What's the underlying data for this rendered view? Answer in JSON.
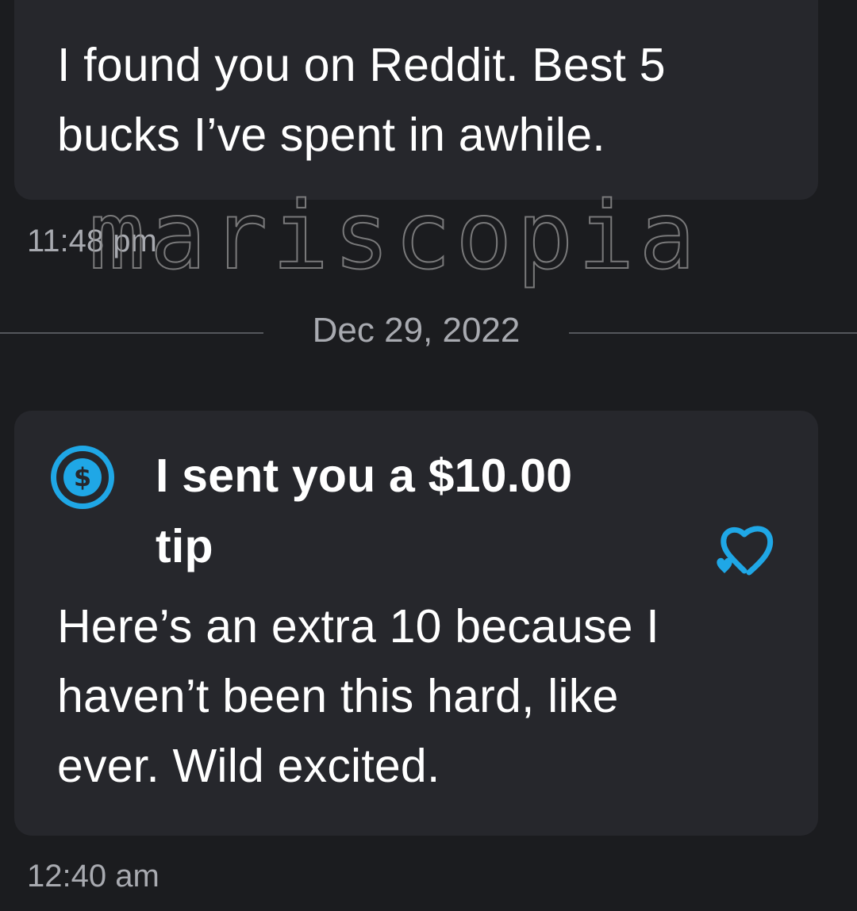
{
  "messages": [
    {
      "text": "I found you on Reddit. Best 5\nbucks I’ve spent in awhile.",
      "time": "11:48 pm"
    },
    {
      "tip": {
        "icon": "dollar-circle-icon",
        "label": "I sent you a $10.00\ntip",
        "reaction_icon": "heart-outline-icon"
      },
      "text": "Here’s an extra 10 because I\nhaven’t been this hard, like\never. Wild excited.",
      "time": "12:40 am"
    }
  ],
  "date_divider": "Dec 29, 2022",
  "watermark": "mariscopia",
  "colors": {
    "background": "#1b1c1f",
    "bubble": "#26272c",
    "accent": "#1fa7e6",
    "muted_text": "#a8aab0"
  }
}
